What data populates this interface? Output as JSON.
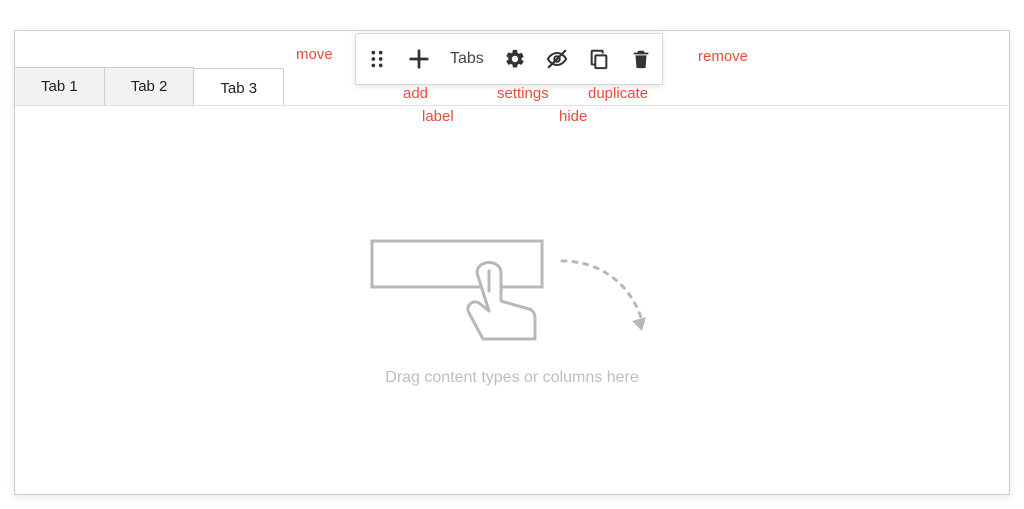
{
  "tabs": {
    "items": [
      {
        "label": "Tab 1",
        "active": false
      },
      {
        "label": "Tab 2",
        "active": false
      },
      {
        "label": "Tab 3",
        "active": true
      }
    ]
  },
  "toolbar": {
    "label": "Tabs"
  },
  "annotations": {
    "move": "move",
    "add": "add",
    "label": "label",
    "settings": "settings",
    "hide": "hide",
    "duplicate": "duplicate",
    "remove": "remove"
  },
  "dropzone": {
    "hint": "Drag content types or columns here"
  }
}
